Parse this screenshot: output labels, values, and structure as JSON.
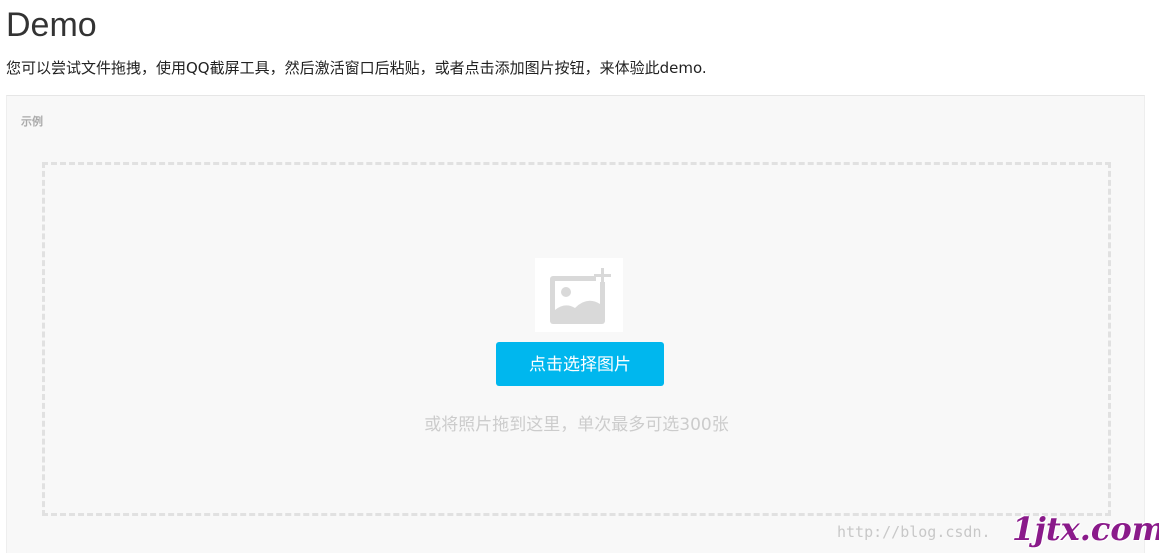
{
  "page": {
    "title": "Demo",
    "description": "您可以尝试文件拖拽，使用QQ截屏工具，然后激活窗口后粘贴，或者点击添加图片按钮，来体验此demo."
  },
  "example": {
    "label": "示例",
    "placeholder_icon": "image-add-icon",
    "pick_button_label": "点击选择图片",
    "drop_hint": "或将照片拖到这里，单次最多可选300张"
  },
  "watermark": {
    "url_text": "http://blog.csdn.",
    "logo_text": "1jtx.com",
    "logo_color": "#8a1a8a"
  },
  "colors": {
    "accent": "#00b7ee",
    "panel_bg": "#f8f8f8",
    "dashed_border": "#e1e1e1"
  }
}
